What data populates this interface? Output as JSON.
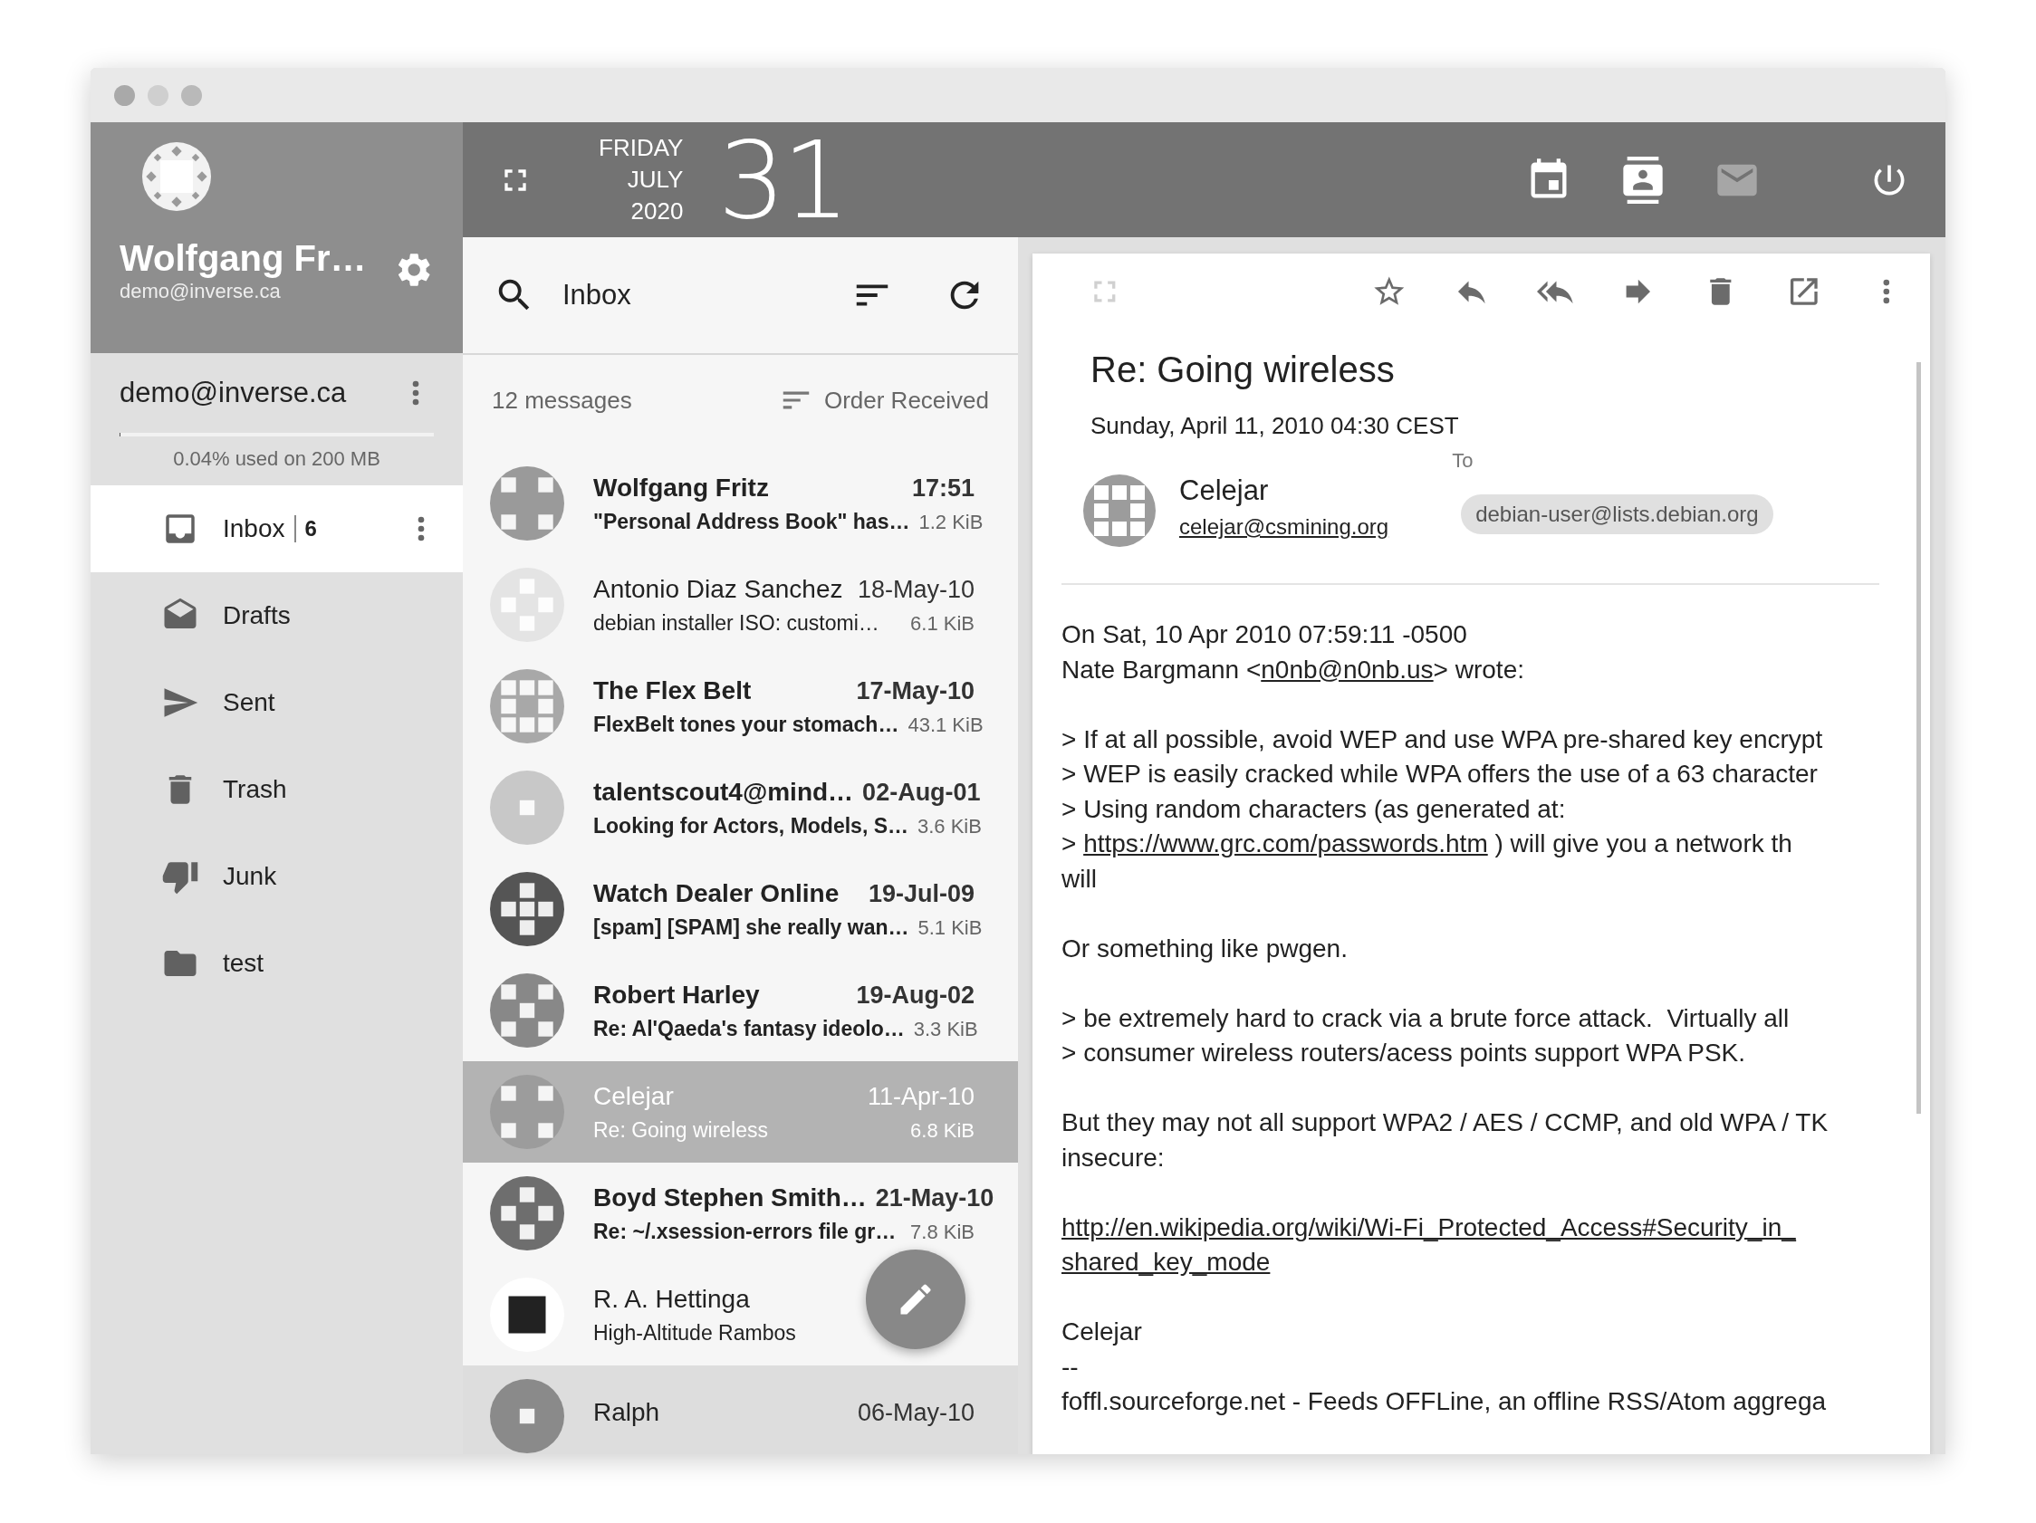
{
  "account": {
    "name": "Wolfgang Fr…",
    "email": "demo@inverse.ca"
  },
  "mailbox": {
    "address": "demo@inverse.ca",
    "quota": {
      "level": 0.0004,
      "text": "0.04% used on 200 MB"
    }
  },
  "folders": [
    {
      "label": "Inbox",
      "count": "6",
      "kind": "inbox",
      "selected": true
    },
    {
      "label": "Drafts",
      "kind": "drafts",
      "selected": false
    },
    {
      "label": "Sent",
      "kind": "sent",
      "selected": false
    },
    {
      "label": "Trash",
      "kind": "trash",
      "selected": false
    },
    {
      "label": "Junk",
      "kind": "junk",
      "selected": false
    },
    {
      "label": "test",
      "kind": "folder",
      "selected": false
    }
  ],
  "date": {
    "weekday": "FRIDAY",
    "month": "JULY",
    "year": "2020",
    "day": "31"
  },
  "apps": [
    {
      "kind": "calendar",
      "selected": false
    },
    {
      "kind": "contacts",
      "selected": false
    },
    {
      "kind": "mail",
      "selected": true
    },
    {
      "kind": "power",
      "selected": false
    }
  ],
  "list": {
    "title": "Inbox",
    "count": "12 messages",
    "order": "Order Received",
    "messages": [
      {
        "sender": "Wolfgang Fritz",
        "date": "17:51",
        "subject": "\"Personal Address Book\" has…",
        "size": "1.2 KiB",
        "unread": true,
        "selected": false,
        "hovered": false
      },
      {
        "sender": "Antonio Diaz Sanchez",
        "date": "18-May-10",
        "subject": "debian installer ISO: customi…",
        "size": "6.1 KiB",
        "unread": false,
        "selected": false,
        "hovered": false
      },
      {
        "sender": "The Flex Belt",
        "date": "17-May-10",
        "subject": "FlexBelt tones your stomach…",
        "size": "43.1 KiB",
        "unread": true,
        "selected": false,
        "hovered": false
      },
      {
        "sender": "talentscout4@mind…",
        "date": "02-Aug-01",
        "subject": "Looking for Actors, Models, S…",
        "size": "3.6 KiB",
        "unread": true,
        "selected": false,
        "hovered": false
      },
      {
        "sender": "Watch Dealer Online",
        "date": "19-Jul-09",
        "subject": "[spam] [SPAM] she really wan…",
        "size": "5.1 KiB",
        "unread": true,
        "selected": false,
        "hovered": false
      },
      {
        "sender": "Robert Harley",
        "date": "19-Aug-02",
        "subject": "Re: Al'Qaeda's fantasy ideolo…",
        "size": "3.3 KiB",
        "unread": true,
        "selected": false,
        "hovered": false
      },
      {
        "sender": "Celejar",
        "date": "11-Apr-10",
        "subject": "Re: Going wireless",
        "size": "6.8 KiB",
        "unread": false,
        "selected": true,
        "hovered": false
      },
      {
        "sender": "Boyd Stephen Smith…",
        "date": "21-May-10",
        "subject": "Re: ~/.xsession-errors file gr…",
        "size": "7.8 KiB",
        "unread": true,
        "selected": false,
        "hovered": false
      },
      {
        "sender": "R. A. Hettinga",
        "subject": "High-Altitude Rambos",
        "unread": false,
        "selected": false,
        "hovered": false
      },
      {
        "sender": "Ralph",
        "date": "06-May-10",
        "unread": false,
        "selected": false,
        "hovered": true
      }
    ]
  },
  "toolbar": [
    {
      "kind": "fullscreen",
      "disabled": true
    },
    {
      "kind": "star",
      "disabled": false
    },
    {
      "kind": "reply",
      "disabled": false
    },
    {
      "kind": "reply-all",
      "disabled": false
    },
    {
      "kind": "forward",
      "disabled": false
    },
    {
      "kind": "delete",
      "disabled": false
    },
    {
      "kind": "open",
      "disabled": false
    },
    {
      "kind": "more",
      "disabled": false
    }
  ],
  "message": {
    "subject": "Re: Going wireless",
    "date": "Sunday, April 11, 2010 04:30 CEST",
    "from_name": "Celejar",
    "from_email": "celejar@csmining.org",
    "to_label": "To",
    "to": [
      "debian-user@lists.debian.org"
    ],
    "body": [
      [
        [
          {
            "text": "On Sat, 10 Apr 2010 07:59:11 -0500"
          }
        ],
        [
          {
            "text": "Nate Bargmann <"
          },
          {
            "text": "n0nb@n0nb.us",
            "link": true
          },
          {
            "text": "> wrote:"
          }
        ]
      ],
      [
        [
          {
            "text": "> If at all possible, avoid WEP and use WPA pre-shared key encrypt"
          }
        ],
        [
          {
            "text": "> WEP is easily cracked while WPA offers the use of a 63 character"
          }
        ],
        [
          {
            "text": "> Using random characters (as generated at:"
          }
        ],
        [
          {
            "text": "> "
          },
          {
            "text": "https://www.grc.com/passwords.htm",
            "link": true
          },
          {
            "text": " ) will give you a network th"
          }
        ],
        [
          {
            "text": "will"
          }
        ]
      ],
      [
        [
          {
            "text": "Or something like pwgen."
          }
        ]
      ],
      [
        [
          {
            "text": "> be extremely hard to crack via a brute force attack.  Virtually all"
          }
        ],
        [
          {
            "text": "> consumer wireless routers/acess points support WPA PSK."
          }
        ]
      ],
      [
        [
          {
            "text": "But they may not all support WPA2 / AES / CCMP, and old WPA / TK"
          }
        ],
        [
          {
            "text": "insecure:"
          }
        ]
      ],
      [
        [
          {
            "text": "http://en.wikipedia.org/wiki/Wi-Fi_Protected_Access#Security_in_",
            "link": true
          }
        ],
        [
          {
            "text": "shared_key_mode",
            "link": true
          }
        ]
      ],
      [
        [
          {
            "text": "Celejar"
          }
        ],
        [
          {
            "text": "--"
          }
        ],
        [
          {
            "text": "foffl.sourceforge.net - Feeds OFFLine, an offline RSS/Atom aggrega"
          }
        ]
      ]
    ]
  }
}
